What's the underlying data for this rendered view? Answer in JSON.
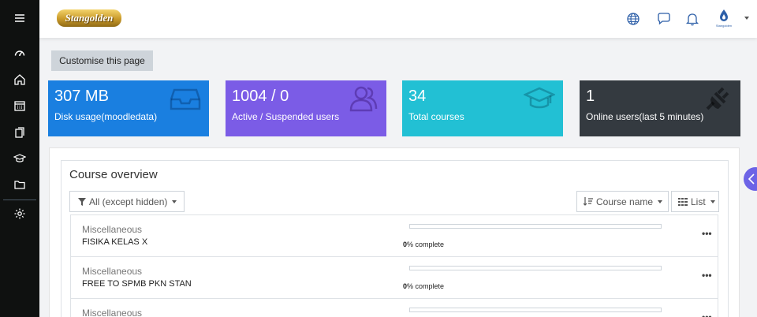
{
  "sidebar": {
    "items": [
      {
        "icon": "menu-icon"
      },
      {
        "icon": "dashboard-icon"
      },
      {
        "icon": "home-icon"
      },
      {
        "icon": "calendar-icon"
      },
      {
        "icon": "files-icon"
      },
      {
        "icon": "graduation-cap-icon"
      },
      {
        "icon": "folder-icon"
      },
      {
        "icon": "gear-icon"
      }
    ]
  },
  "header": {
    "logo_text": "Stangolden",
    "icons": [
      "globe-icon",
      "chat-icon",
      "bell-icon"
    ],
    "avatar_text": "Stangolden"
  },
  "customise_label": "Customise this page",
  "stats": [
    {
      "value": "307 MB",
      "label": "Disk usage(moodledata)",
      "color": "#1a7fe0",
      "icon": "inbox-icon"
    },
    {
      "value": "1004 / 0",
      "label": "Active / Suspended users",
      "color": "#7b5ce6",
      "icon": "users-icon"
    },
    {
      "value": "34",
      "label": "Total courses",
      "color": "#22c0d4",
      "icon": "graduation-cap-icon"
    },
    {
      "value": "1",
      "label": "Online users(last 5 minutes)",
      "color": "#343a40",
      "icon": "plug-icon"
    }
  ],
  "overview": {
    "title": "Course overview",
    "filter_label": "All (except hidden)",
    "sort_label": "Course name",
    "view_label": "List",
    "courses": [
      {
        "category": "Miscellaneous",
        "name": "FISIKA KELAS X",
        "percent": "0",
        "complete_text": "% complete",
        "progress": 0
      },
      {
        "category": "Miscellaneous",
        "name": "FREE TO SPMB PKN STAN",
        "percent": "0",
        "complete_text": "% complete",
        "progress": 0
      },
      {
        "category": "Miscellaneous",
        "name": "",
        "percent": "",
        "complete_text": "",
        "progress": 0
      }
    ],
    "more_label": "•••"
  }
}
